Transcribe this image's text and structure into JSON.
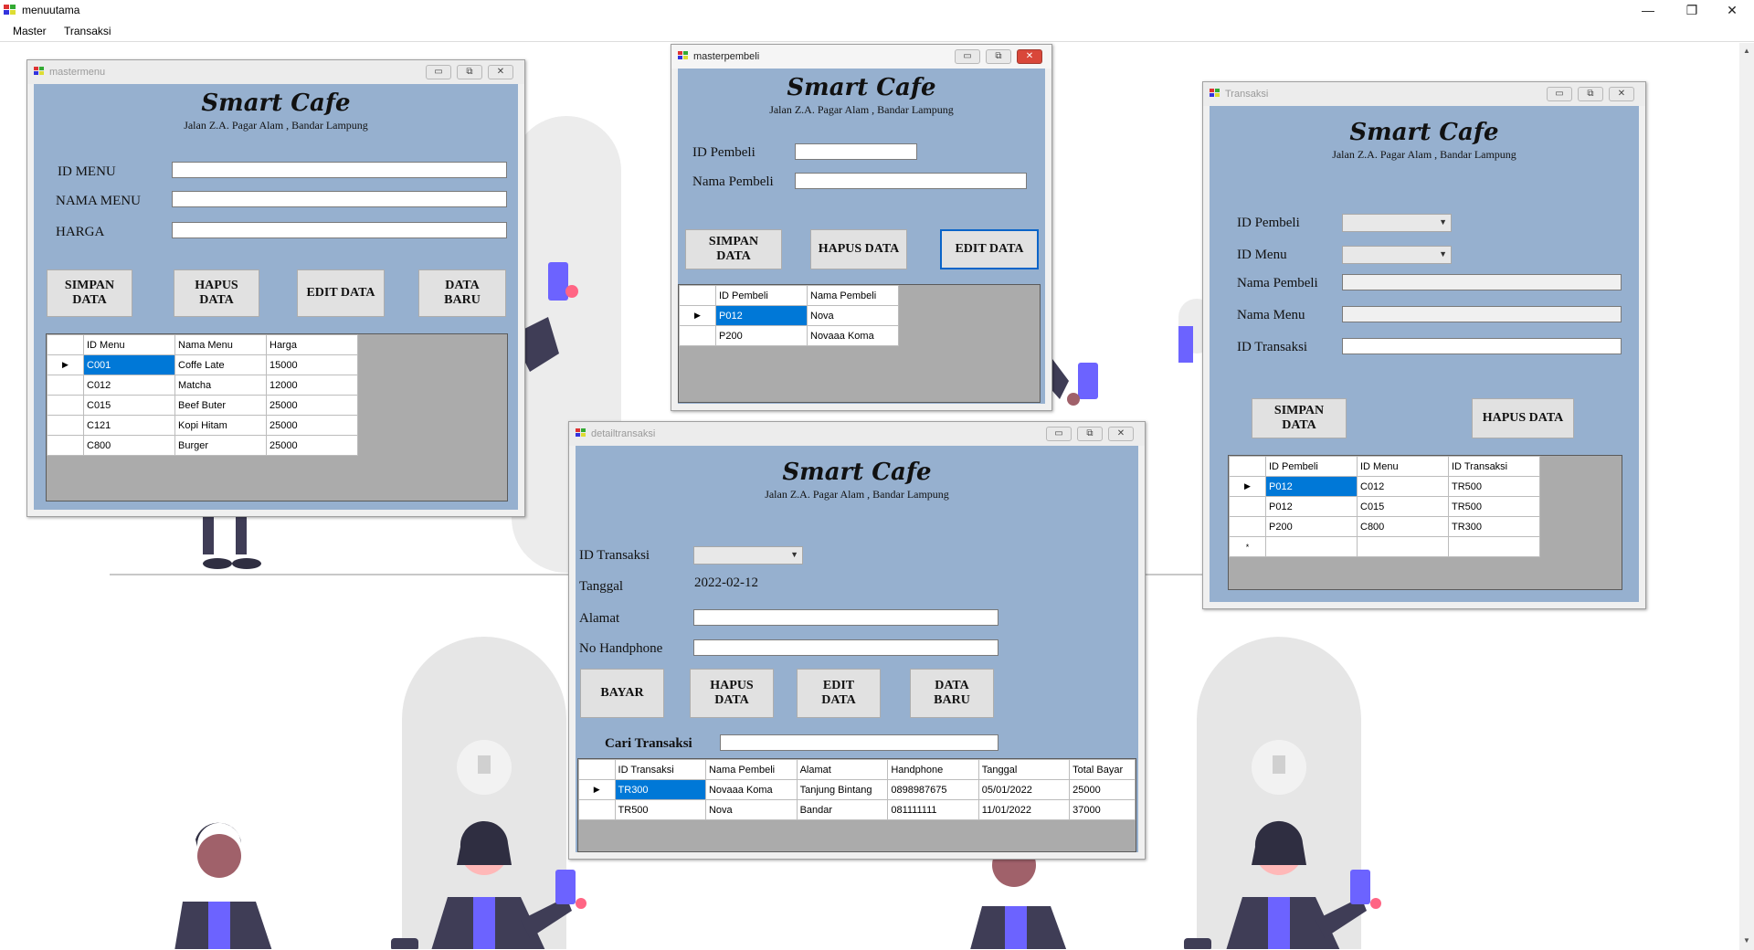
{
  "app": {
    "title": "menuutama",
    "menu": [
      "Master",
      "Transaksi"
    ],
    "controls": {
      "minimize": "—",
      "restore": "❐",
      "close": "✕"
    }
  },
  "brand": {
    "name": "Smart Cafe",
    "address": "Jalan Z.A. Pagar Alam , Bandar Lampung"
  },
  "window_buttons": {
    "minimize": "▭",
    "restore": "⧉",
    "close": "✕"
  },
  "mastermenu": {
    "title": "mastermenu",
    "labels": {
      "id": "ID MENU",
      "nama": "NAMA MENU",
      "harga": "HARGA"
    },
    "buttons": {
      "simpan": "SIMPAN DATA",
      "hapus": "HAPUS DATA",
      "edit": "EDIT DATA",
      "baru": "DATA BARU"
    },
    "columns": [
      "ID Menu",
      "Nama Menu",
      "Harga"
    ],
    "rows": [
      [
        "C001",
        "Coffe Late",
        "15000"
      ],
      [
        "C012",
        "Matcha",
        "12000"
      ],
      [
        "C015",
        "Beef Buter",
        "25000"
      ],
      [
        "C121",
        "Kopi Hitam",
        "25000"
      ],
      [
        "C800",
        "Burger",
        "25000"
      ]
    ]
  },
  "masterpembeli": {
    "title": "masterpembeli",
    "labels": {
      "id": "ID Pembeli",
      "nama": "Nama Pembeli"
    },
    "buttons": {
      "simpan": "SIMPAN DATA",
      "hapus": "HAPUS DATA",
      "edit": "EDIT DATA"
    },
    "columns": [
      "ID Pembeli",
      "Nama Pembeli"
    ],
    "rows": [
      [
        "P012",
        "Nova"
      ],
      [
        "P200",
        "Novaaa Koma"
      ]
    ]
  },
  "transaksi": {
    "title": "Transaksi",
    "labels": {
      "id_pembeli": "ID Pembeli",
      "id_menu": "ID Menu",
      "nama_pembeli": "Nama Pembeli",
      "nama_menu": "Nama Menu",
      "id_transaksi": "ID Transaksi"
    },
    "buttons": {
      "simpan": "SIMPAN DATA",
      "hapus": "HAPUS DATA"
    },
    "columns": [
      "ID Pembeli",
      "ID Menu",
      "ID Transaksi"
    ],
    "rows": [
      [
        "P012",
        "C012",
        "TR500"
      ],
      [
        "P012",
        "C015",
        "TR500"
      ],
      [
        "P200",
        "C800",
        "TR300"
      ]
    ],
    "new_row_marker": "*"
  },
  "detailtransaksi": {
    "title": "detailtransaksi",
    "labels": {
      "id_transaksi": "ID Transaksi",
      "tanggal": "Tanggal",
      "alamat": "Alamat",
      "hp": "No Handphone",
      "cari": "Cari Transaksi"
    },
    "tanggal_value": "2022-02-12",
    "buttons": {
      "bayar": "BAYAR",
      "hapus": "HAPUS DATA",
      "edit": "EDIT DATA",
      "baru": "DATA BARU"
    },
    "columns": [
      "ID Transaksi",
      "Nama Pembeli",
      "Alamat",
      "Handphone",
      "Tanggal",
      "Total Bayar"
    ],
    "rows": [
      [
        "TR300",
        "Novaaa Koma",
        "Tanjung Bintang",
        "0898987675",
        "05/01/2022",
        "25000"
      ],
      [
        "TR500",
        "Nova",
        "Bandar",
        "081111111",
        "11/01/2022",
        "37000"
      ]
    ]
  },
  "colors": {
    "client_bg": "#96b0cf",
    "selection": "#0078d7",
    "grid_bg": "#ababab",
    "accent_person": "#6c63ff"
  }
}
